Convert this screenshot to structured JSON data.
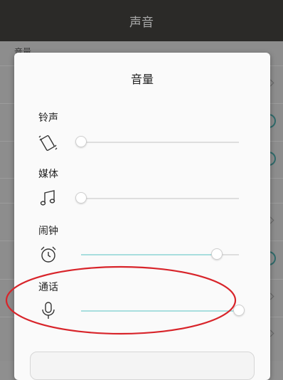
{
  "app_bar": {
    "title": "声音"
  },
  "background": {
    "section_label": "音量"
  },
  "dialog": {
    "title": "音量",
    "sliders": [
      {
        "label": "铃声",
        "icon": "vibrate-phone-icon",
        "level": 0.0
      },
      {
        "label": "媒体",
        "icon": "music-note-icon",
        "level": 0.0
      },
      {
        "label": "闹钟",
        "icon": "alarm-clock-icon",
        "level": 0.86
      },
      {
        "label": "通话",
        "icon": "microphone-icon",
        "level": 1.0
      }
    ]
  },
  "colors": {
    "accent": "#a8dede",
    "annotation": "#d8242a",
    "appbar": "#2b2a28"
  }
}
